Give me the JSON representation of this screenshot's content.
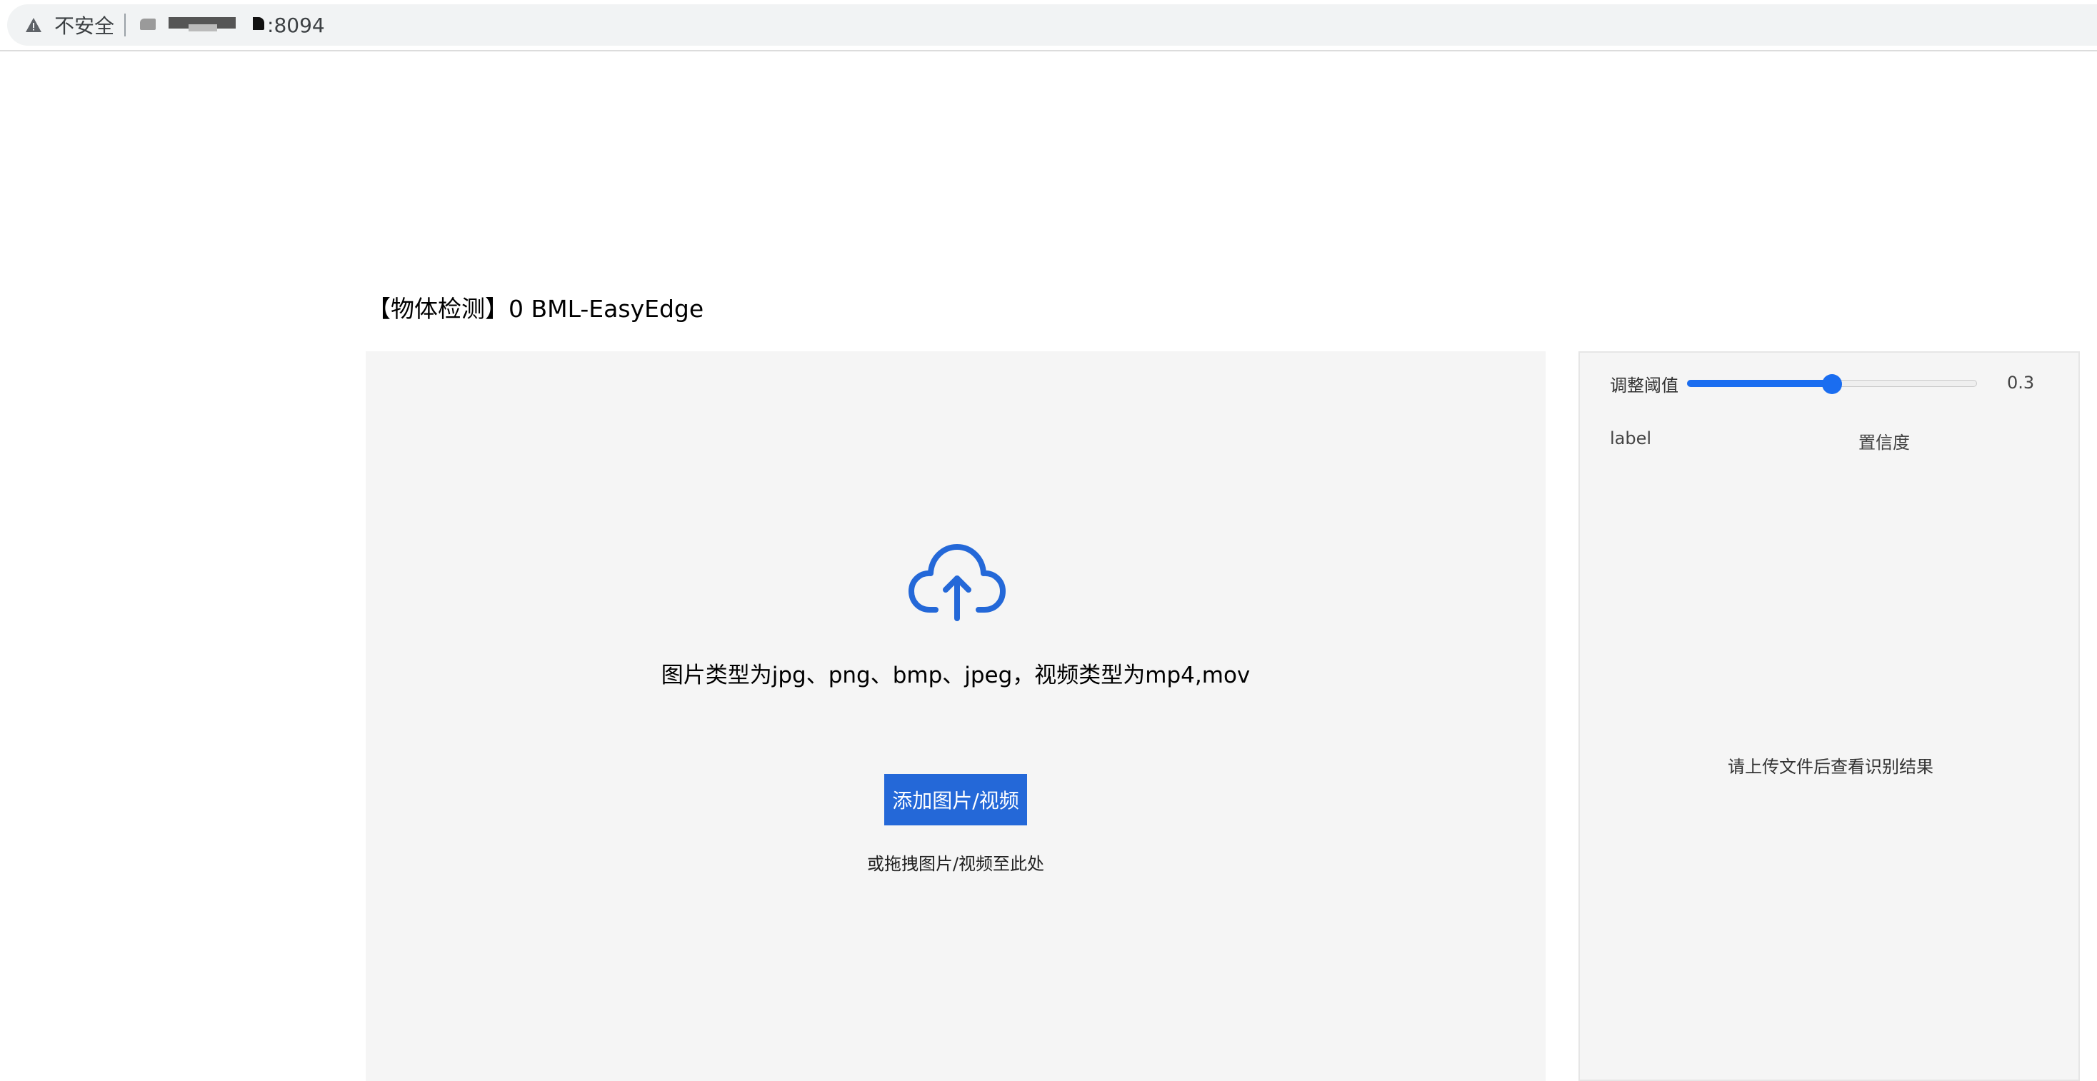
{
  "browser": {
    "security_label": "不安全",
    "url_suffix": ":8094"
  },
  "page": {
    "title": "【物体检测】0  BML-EasyEdge"
  },
  "upload": {
    "types_hint": "图片类型为jpg、png、bmp、jpeg，视频类型为mp4,mov",
    "add_button_label": "添加图片/视频",
    "drag_hint": "或拖拽图片/视频至此处",
    "accent_color": "#2468d8"
  },
  "results": {
    "threshold_label": "调整阈值",
    "threshold_value": "0.3",
    "slider_fraction": 0.5,
    "columns": {
      "label": "label",
      "confidence": "置信度"
    },
    "empty_message": "请上传文件后查看识别结果"
  },
  "icons": {
    "warning": "warning-triangle-icon",
    "upload": "cloud-upload-icon"
  }
}
